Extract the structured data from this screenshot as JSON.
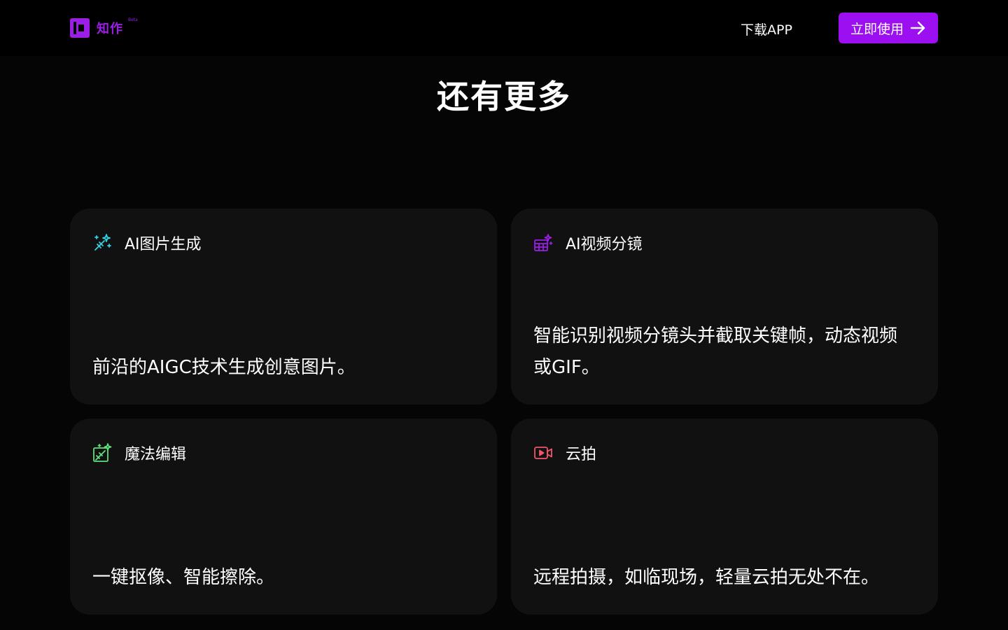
{
  "header": {
    "brand": "知作",
    "badge": "Beta",
    "download_label": "下载APP",
    "cta_label": "立即使用",
    "brand_color": "#9b0ff0"
  },
  "section": {
    "title": "还有更多"
  },
  "cards": [
    {
      "title": "AI图片生成",
      "description": "前沿的AIGC技术生成创意图片。",
      "icon": "magic-wand-sparkles-icon",
      "icon_color": "#2fd3e6"
    },
    {
      "title": "AI视频分镜",
      "description": "智能识别视频分镜头并截取关键帧，动态视频或GIF。",
      "icon": "film-sparkle-icon",
      "icon_color": "#9b1de6"
    },
    {
      "title": "魔法编辑",
      "description": "一键抠像、智能擦除。",
      "icon": "magic-edit-icon",
      "icon_color": "#5fe07a"
    },
    {
      "title": "云拍",
      "description": "远程拍摄，如临现场，轻量云拍无处不在。",
      "icon": "video-camera-icon",
      "icon_color": "#f0566a"
    }
  ]
}
